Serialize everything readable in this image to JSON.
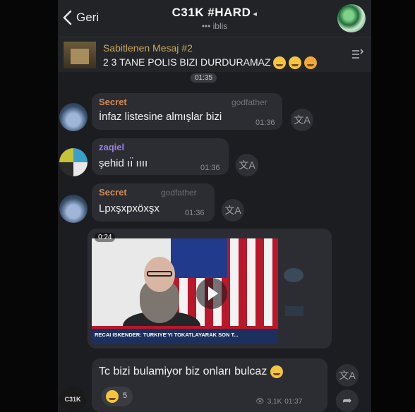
{
  "header": {
    "back_label": "Geri",
    "title": "C31K #HARD",
    "subtitle": "••• iblis"
  },
  "pinned": {
    "title": "Sabitlenen Mesaj #2",
    "text": "2 3 TANE POLIS BIZI DURDURAMAZ",
    "time": "01:35"
  },
  "messages": [
    {
      "sender": "Secret",
      "role": "godfather",
      "text": "İnfaz listesine almışlar bizi",
      "time": "01:36",
      "sender_color": "#d08a57"
    },
    {
      "sender": "zaqiel",
      "role": "",
      "text": "şehid ıı̈ ıııı",
      "time": "01:36",
      "sender_color": "#9b7ee8"
    },
    {
      "sender": "Secret",
      "role": "godfather",
      "text": "Lpxşxpxöxşx",
      "time": "01:36",
      "sender_color": "#d08a57"
    }
  ],
  "video": {
    "duration": "0:24",
    "caption": "RECAI ISKENDER: TURKIYE'YI TOKATLAYARAK SON T..."
  },
  "last_message": {
    "text": "Tc bizi bulamiyor biz onları bulcaz",
    "reaction_count": "5",
    "views": "3,1K",
    "time": "01:37"
  },
  "logo_text": "C31K",
  "icons": {
    "back": "chevron-left-icon",
    "mute": "mute-icon",
    "translate": "translate-icon",
    "play": "play-icon",
    "share": "share-icon",
    "views": "eye-icon",
    "pin": "pin-list-icon"
  }
}
